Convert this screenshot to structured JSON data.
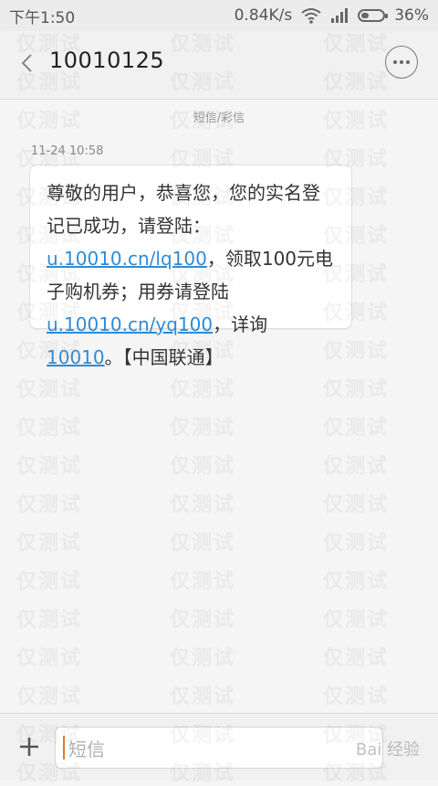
{
  "status_bar": {
    "time": "下午1:50",
    "network_speed": "0.84K/s",
    "battery_percent": "36%",
    "battery_level": 0.36,
    "icons": [
      "wifi-icon",
      "signal-icon",
      "battery-icon"
    ]
  },
  "header": {
    "title": "10010125",
    "back_icon": "back-arrow-icon",
    "more_icon": "more-options-icon"
  },
  "conversation": {
    "section_label": "短信/彩信",
    "messages": [
      {
        "timestamp": "11-24 10:58",
        "text_1": "尊敬的用户，恭喜您，您的实名登记已成功，请登陆：",
        "link_1": "u.10010.cn/lq100",
        "text_2": "，领取100元电子购机券；用券请登陆",
        "link_2": "u.10010.cn/yq100",
        "text_3": "，详询",
        "link_3": "10010",
        "text_4": "。【中国联通】"
      }
    ]
  },
  "composer": {
    "placeholder": "短信",
    "plus_icon": "plus-icon"
  },
  "watermark": {
    "text": "仅测试",
    "corner_text": "Bai 经验"
  },
  "colors": {
    "link": "#2e8bd6",
    "background": "#f5f5f5",
    "caret": "#e07a2e"
  }
}
